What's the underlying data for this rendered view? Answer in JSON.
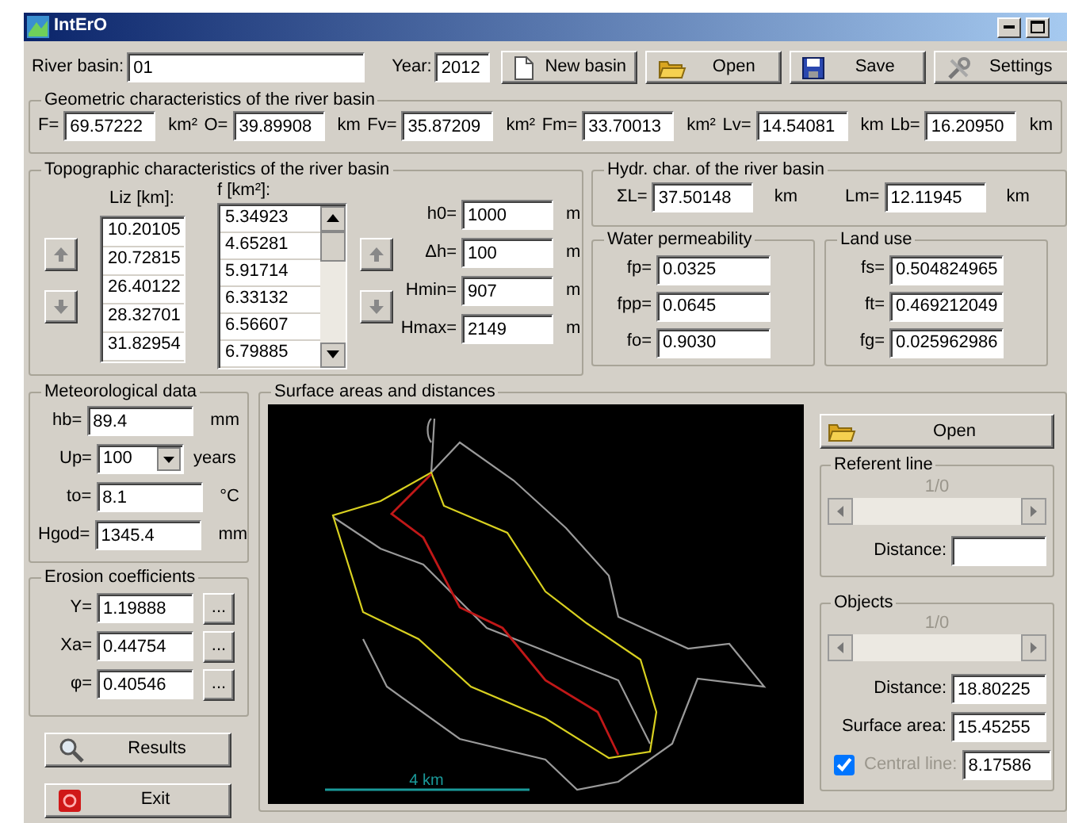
{
  "window": {
    "title": "IntErO"
  },
  "header": {
    "river_basin": {
      "label": "River basin:",
      "value": "01"
    },
    "year": {
      "label": "Year:",
      "value": "2012"
    },
    "buttons": [
      {
        "kind": "new",
        "label": "New basin"
      },
      {
        "kind": "open",
        "label": "Open"
      },
      {
        "kind": "save",
        "label": "Save"
      },
      {
        "kind": "settings",
        "label": "Settings"
      }
    ]
  },
  "geometric": {
    "title": "Geometric characteristics of the river basin",
    "fields": [
      {
        "label": "F=",
        "value": "69.57222",
        "unit": "km²"
      },
      {
        "label": "O=",
        "value": "39.89908",
        "unit": "km"
      },
      {
        "label": "Fv=",
        "value": "35.87209",
        "unit": "km²"
      },
      {
        "label": "Fm=",
        "value": "33.70013",
        "unit": "km²"
      },
      {
        "label": "Lv=",
        "value": "14.54081",
        "unit": "km"
      },
      {
        "label": "Lb=",
        "value": "16.20950",
        "unit": "km"
      }
    ]
  },
  "topographic": {
    "title": "Topographic characteristics of the river basin",
    "liz": {
      "label": "Liz [km]:",
      "values": [
        "10.20105",
        "20.72815",
        "26.40122",
        "28.32701",
        "31.82954"
      ]
    },
    "f": {
      "label": "f [km²]:",
      "values": [
        "5.34923",
        "4.65281",
        "5.91714",
        "6.33132",
        "6.56607",
        "6.79885"
      ]
    },
    "fields": [
      {
        "label": "h0=",
        "value": "1000",
        "unit": "m"
      },
      {
        "label": "Δh=",
        "value": "100",
        "unit": "m"
      },
      {
        "label": "Hmin=",
        "value": "907",
        "unit": "m"
      },
      {
        "label": "Hmax=",
        "value": "2149",
        "unit": "m"
      }
    ]
  },
  "hydr": {
    "title": "Hydr. char. of the river basin",
    "fields": [
      {
        "label": "ΣL=",
        "value": "37.50148",
        "unit": "km"
      },
      {
        "label": "Lm=",
        "value": "12.11945",
        "unit": "km"
      }
    ]
  },
  "water_permeability": {
    "title": "Water permeability",
    "fields": [
      {
        "label": "fp=",
        "value": "0.0325"
      },
      {
        "label": "fpp=",
        "value": "0.0645"
      },
      {
        "label": "fo=",
        "value": "0.9030"
      }
    ]
  },
  "land_use": {
    "title": "Land use",
    "fields": [
      {
        "label": "fs=",
        "value": "0.504824965"
      },
      {
        "label": "ft=",
        "value": "0.469212049"
      },
      {
        "label": "fg=",
        "value": "0.025962986"
      }
    ]
  },
  "meteorological": {
    "title": "Meteorological data",
    "fields": [
      {
        "kind": "text",
        "label": "hb=",
        "value": "89.4",
        "unit": "mm"
      },
      {
        "kind": "select",
        "label": "Up=",
        "value": "100",
        "unit": "years"
      },
      {
        "kind": "text",
        "label": "to=",
        "value": "8.1",
        "unit": "°C"
      },
      {
        "kind": "text",
        "label": "Hgod=",
        "value": "1345.4",
        "unit": "mm"
      }
    ]
  },
  "erosion": {
    "title": "Erosion coefficients",
    "fields": [
      {
        "label": "Y=",
        "value": "1.19888",
        "button": "..."
      },
      {
        "label": "Xa=",
        "value": "0.44754",
        "button": "..."
      },
      {
        "label": "φ=",
        "value": "0.40546",
        "button": "..."
      }
    ]
  },
  "actions": [
    {
      "kind": "results",
      "label": "Results"
    },
    {
      "kind": "exit",
      "label": "Exit"
    }
  ],
  "surface": {
    "title": "Surface areas and distances",
    "map": {
      "scale_label": "4 km"
    },
    "open_button": "Open",
    "referent_line": {
      "title": "Referent line",
      "counter": "1/0",
      "distance_label": "Distance:"
    },
    "objects": {
      "title": "Objects",
      "counter": "1/0",
      "distance": {
        "label": "Distance:",
        "value": "18.80225"
      },
      "surface_area": {
        "label": "Surface area:",
        "value": "15.45255"
      },
      "central_line": {
        "label": "Central line:",
        "checked": true,
        "disabled": true,
        "value": "8.17586"
      }
    }
  }
}
